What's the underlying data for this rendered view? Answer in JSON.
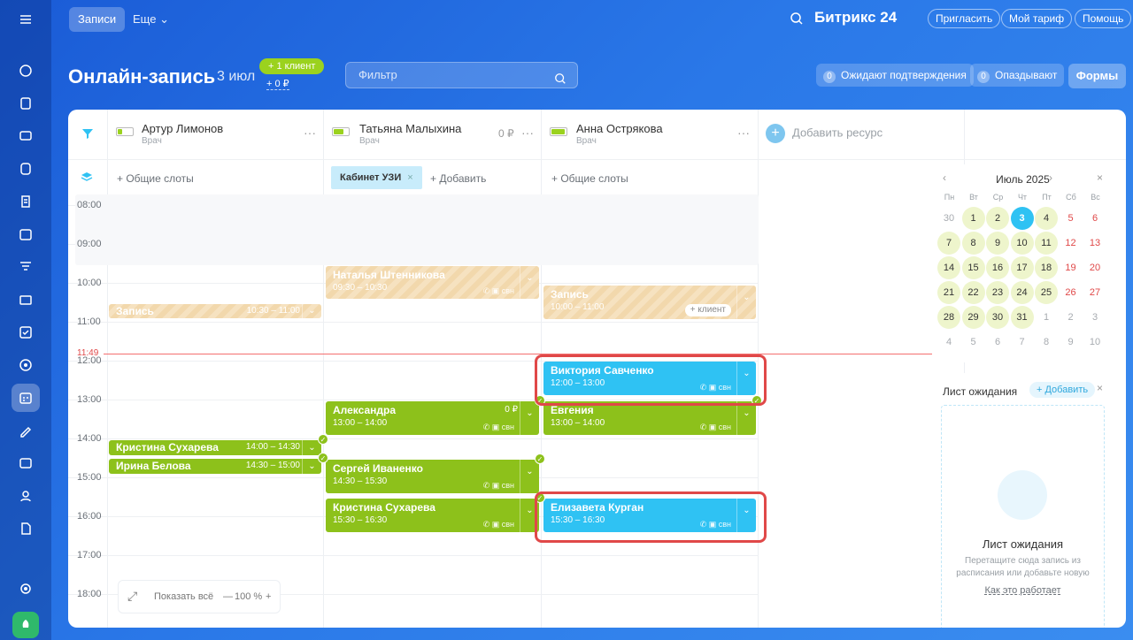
{
  "topbar": {
    "tab_records": "Записи",
    "tab_more": "Еще",
    "brand": "Битрикс 24",
    "invite": "Пригласить",
    "tariff": "Мой тариф",
    "help": "Помощь"
  },
  "header": {
    "title": "Онлайн-запись",
    "date": "3 июл",
    "add_client": "+ 1 клиент",
    "sum": "+ 0 ₽",
    "filter_placeholder": "Фильтр",
    "awaiting_count": "0",
    "awaiting_label": "Ожидают подтверждения",
    "late_count": "0",
    "late_label": "Опаздывают",
    "forms": "Формы"
  },
  "resources": [
    {
      "name": "Артур Лимонов",
      "role": "Врач",
      "money": "",
      "battery": 0.3
    },
    {
      "name": "Татьяна Малыхина",
      "role": "Врач",
      "money": "0 ₽",
      "battery": 0.6
    },
    {
      "name": "Анна Острякова",
      "role": "Врач",
      "money": "",
      "battery": 0.85
    }
  ],
  "add_resource": "Добавить ресурс",
  "slots": {
    "common": "+ Общие слоты",
    "cabinet": "Кабинет УЗИ",
    "add": "+ Добавить"
  },
  "hours": [
    "08:00",
    "09:00",
    "10:00",
    "11:00",
    "12:00",
    "13:00",
    "14:00",
    "15:00",
    "16:00",
    "17:00",
    "18:00"
  ],
  "now_label": "11:49",
  "events": [
    {
      "name": "Запись",
      "time": "10:30 – 11:00"
    },
    {
      "name": "Наталья Штенникова",
      "time": "09:30 – 10:30"
    },
    {
      "name": "Запись",
      "time": "10:00 – 11:00",
      "tag": "+ клиент"
    },
    {
      "name": "Виктория Савченко",
      "time": "12:00 – 13:00"
    },
    {
      "name": "Александра",
      "time": "13:00 – 14:00",
      "money": "0 ₽"
    },
    {
      "name": "Евгения",
      "time": "13:00 – 14:00"
    },
    {
      "name": "Кристина Сухарева",
      "time": "14:00 – 14:30"
    },
    {
      "name": "Ирина Белова",
      "time": "14:30 – 15:00"
    },
    {
      "name": "Сергей Иваненко",
      "time": "14:30 – 15:30"
    },
    {
      "name": "Кристина Сухарева",
      "time": "15:30 – 16:30"
    },
    {
      "name": "Елизавета Курган",
      "time": "15:30 – 16:30"
    }
  ],
  "event_icons": "✆ ▣ свн",
  "calendar": {
    "month": "Июль 2025",
    "weekdays": [
      "Пн",
      "Вт",
      "Ср",
      "Чт",
      "Пт",
      "Сб",
      "Вс"
    ],
    "rows": [
      [
        "30",
        "1",
        "2",
        "3",
        "4",
        "5",
        "6"
      ],
      [
        "7",
        "8",
        "9",
        "10",
        "11",
        "12",
        "13"
      ],
      [
        "14",
        "15",
        "16",
        "17",
        "18",
        "19",
        "20"
      ],
      [
        "21",
        "22",
        "23",
        "24",
        "25",
        "26",
        "27"
      ],
      [
        "28",
        "29",
        "30",
        "31",
        "1",
        "2",
        "3"
      ],
      [
        "4",
        "5",
        "6",
        "7",
        "8",
        "9",
        "10"
      ]
    ]
  },
  "waitlist": {
    "title": "Лист ожидания",
    "add": "+ Добавить",
    "heading": "Лист ожидания",
    "desc": "Перетащите сюда запись из расписания или добавьте новую",
    "link": "Как это работает"
  },
  "zoom": {
    "show_all": "Показать всё",
    "minus": "—",
    "value": "100 %",
    "plus": "+"
  },
  "colors": {
    "green": "#8dc11b",
    "blue": "#2fc2f3",
    "now_line": "#f36f6f",
    "highlight": "#e04848"
  }
}
